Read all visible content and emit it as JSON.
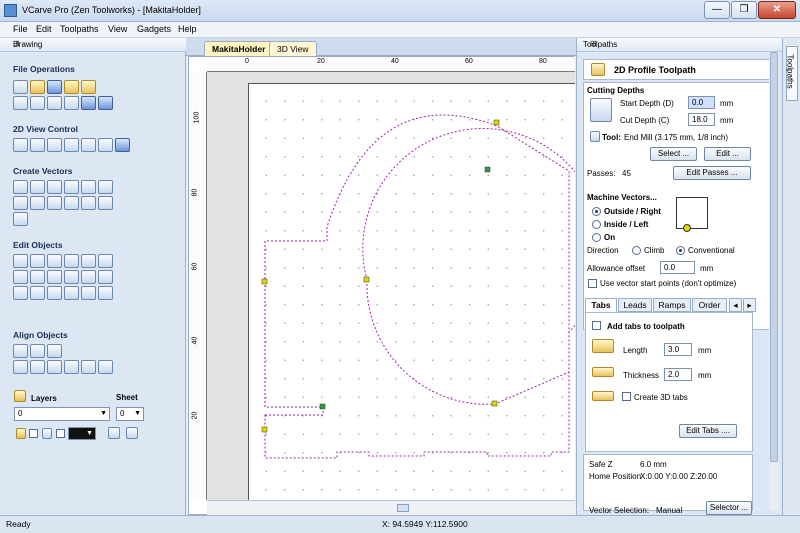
{
  "window": {
    "title": "VCarve Pro (Zen Toolworks) - [MakitaHolder]",
    "min": "—",
    "max": "❐",
    "close": "✕"
  },
  "menu": [
    "File",
    "Edit",
    "Toolpaths",
    "View",
    "Gadgets",
    "Help"
  ],
  "left_panel": {
    "title": "Drawing",
    "pin": "⊞",
    "sections": {
      "file_ops": "File Operations",
      "view_control": "2D View Control",
      "create_vectors": "Create Vectors",
      "edit_objects": "Edit Objects",
      "align_objects": "Align Objects"
    },
    "layers_label": "Layers",
    "sheet_label": "Sheet",
    "layer_value": "0",
    "sheet_value": "0"
  },
  "doc_tabs": [
    "MakitaHolder",
    "3D View"
  ],
  "rulers": {
    "h_ticks": [
      "0",
      "20",
      "40",
      "60",
      "80"
    ],
    "v_ticks": [
      "100",
      "80",
      "60",
      "40",
      "20"
    ]
  },
  "right_panel": {
    "title": "Toolpaths",
    "pin": "⊞",
    "header": "2D Profile Toolpath",
    "cutting_depths": "Cutting Depths",
    "start_depth_label": "Start Depth (D)",
    "start_depth_value": "0.0",
    "start_unit": "mm",
    "cut_depth_label": "Cut Depth (C)",
    "cut_depth_value": "18.0",
    "cut_unit": "mm",
    "tool_label": "Tool:",
    "tool_value": "End Mill (3.175 mm, 1/8 inch)",
    "select_btn": "Select ...",
    "edit_btn": "Edit ...",
    "passes_label": "Passes:",
    "passes_value": "45",
    "edit_passes_btn": "Edit Passes ...",
    "machine_vectors": "Machine Vectors...",
    "outside": "Outside / Right",
    "inside": "Inside / Left",
    "on": "On",
    "direction_label": "Direction",
    "climb": "Climb",
    "conventional": "Conventional",
    "allowance_label": "Allowance offset",
    "allowance_value": "0.0",
    "allowance_unit": "mm",
    "start_points": "Use vector start points (don't optimize)",
    "tabs": [
      "Tabs",
      "Leads",
      "Ramps",
      "Order"
    ],
    "tab_scroll_left": "◂",
    "tab_scroll_right": "▸",
    "add_tabs": "Add tabs to toolpath",
    "length_label": "Length",
    "length_value": "3.0",
    "length_unit": "mm",
    "thickness_label": "Thickness",
    "thickness_value": "2.0",
    "thickness_unit": "mm",
    "create_3d": "Create 3D tabs",
    "edit_tabs_btn": "Edit Tabs ....",
    "safe_z_label": "Safe Z",
    "safe_z_value": "6.0 mm",
    "home_label": "Home Position",
    "home_value": "X:0.00 Y:0.00 Z:20.00",
    "vector_sel_label": "Vector Selection:",
    "vector_sel_value": "Manual",
    "selector_btn": "Selector ..."
  },
  "right_strip": {
    "tab": "Toolpaths"
  },
  "status": {
    "left": "Ready",
    "coords": "X: 94.5949 Y:112.5900"
  },
  "colors": {
    "toolpath": "#a21caf",
    "node": "#2ea043",
    "tab_marker": "#e2d700"
  }
}
